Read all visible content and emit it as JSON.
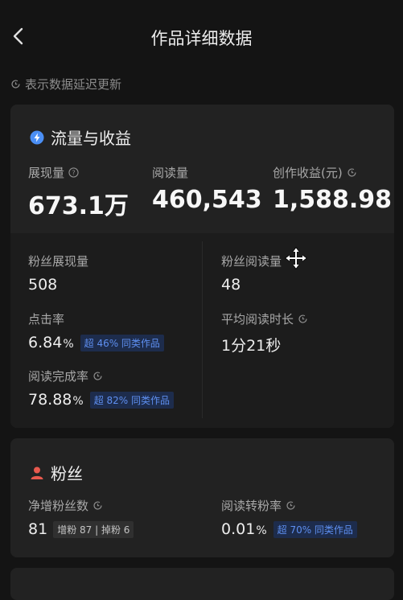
{
  "header": {
    "title": "作品详细数据"
  },
  "notice": "表示数据延迟更新",
  "traffic": {
    "section_title": "流量与收益",
    "impressions": {
      "label": "展现量",
      "value": "673.1万"
    },
    "reads": {
      "label": "阅读量",
      "value": "460,543"
    },
    "income": {
      "label": "创作收益(元)",
      "value": "1,588.98"
    },
    "fan_impressions": {
      "label": "粉丝展现量",
      "value": "508"
    },
    "fan_reads": {
      "label": "粉丝阅读量",
      "value": "48"
    },
    "ctr": {
      "label": "点击率",
      "value": "6.84",
      "unit": "%",
      "badge": "超 46% 同类作品"
    },
    "avg_read_time": {
      "label": "平均阅读时长",
      "value": "1分21秒"
    },
    "completion": {
      "label": "阅读完成率",
      "value": "78.88",
      "unit": "%",
      "badge": "超 82% 同类作品"
    }
  },
  "fans": {
    "section_title": "粉丝",
    "net_gain": {
      "label": "净增粉丝数",
      "value": "81",
      "gain": "增粉 87",
      "loss": "掉粉 6"
    },
    "conversion": {
      "label": "阅读转粉率",
      "value": "0.01",
      "unit": "%",
      "badge": "超 70% 同类作品"
    }
  },
  "colors": {
    "background": "#141414",
    "card": "#222222",
    "accent": "#5e8ff0",
    "fan_icon": "#e8594e"
  },
  "icons": [
    "back-chevron-icon",
    "clock-refresh-icon",
    "help-circle-icon",
    "lightning-icon",
    "person-icon",
    "move-cursor-icon"
  ]
}
